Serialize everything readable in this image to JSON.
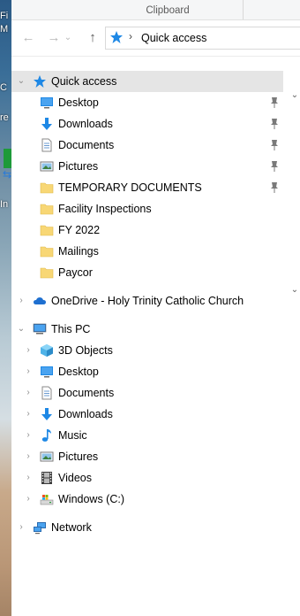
{
  "desktop": {
    "texts": [
      "Fi",
      "M",
      "C",
      "re",
      "In"
    ]
  },
  "ribbon": {
    "group_label": "Clipboard"
  },
  "navbar": {
    "back": "←",
    "forward": "→",
    "recent": "⌄",
    "up": "↑",
    "address_separator": "›",
    "address_location": "Quick access"
  },
  "nav_pane": {
    "quick_access": {
      "label": "Quick access",
      "items": [
        {
          "label": "Desktop",
          "icon": "desktop-icon",
          "pinned": true
        },
        {
          "label": "Downloads",
          "icon": "downloads-icon",
          "pinned": true
        },
        {
          "label": "Documents",
          "icon": "documents-icon",
          "pinned": true
        },
        {
          "label": "Pictures",
          "icon": "pictures-icon",
          "pinned": true
        },
        {
          "label": "TEMPORARY DOCUMENTS",
          "icon": "folder-icon",
          "pinned": true
        },
        {
          "label": "Facility Inspections",
          "icon": "folder-icon",
          "pinned": false
        },
        {
          "label": "FY 2022",
          "icon": "folder-icon",
          "pinned": false
        },
        {
          "label": "Mailings",
          "icon": "folder-icon",
          "pinned": false
        },
        {
          "label": "Paycor",
          "icon": "folder-icon",
          "pinned": false
        }
      ]
    },
    "onedrive": {
      "label": "OneDrive - Holy Trinity Catholic Church"
    },
    "this_pc": {
      "label": "This PC",
      "items": [
        {
          "label": "3D Objects",
          "icon": "3d-objects-icon"
        },
        {
          "label": "Desktop",
          "icon": "desktop-icon"
        },
        {
          "label": "Documents",
          "icon": "documents-icon"
        },
        {
          "label": "Downloads",
          "icon": "downloads-icon"
        },
        {
          "label": "Music",
          "icon": "music-icon"
        },
        {
          "label": "Pictures",
          "icon": "pictures-icon"
        },
        {
          "label": "Videos",
          "icon": "videos-icon"
        },
        {
          "label": "Windows (C:)",
          "icon": "drive-icon"
        }
      ]
    },
    "network": {
      "label": "Network"
    }
  },
  "colors": {
    "selection": "#e5e5e5",
    "folder": "#f8d775",
    "accent_blue": "#1e88e5"
  }
}
